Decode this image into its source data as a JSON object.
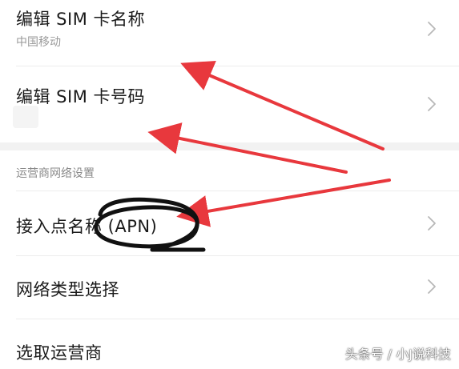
{
  "settings": {
    "items": [
      {
        "label": "编辑 SIM 卡名称",
        "sublabel": "中国移动"
      },
      {
        "label": "编辑 SIM 卡号码"
      }
    ],
    "section_header": "运营商网络设置",
    "network_items": [
      {
        "label": "接入点名称 (APN)"
      },
      {
        "label": "网络类型选择"
      },
      {
        "label": "选取运营商"
      }
    ]
  },
  "annotations": {
    "arrow_color": "#e8383d",
    "circle_color": "#111111",
    "icons": [
      "chevron-right-icon"
    ]
  },
  "watermark": "头条号 / 小J说科技"
}
